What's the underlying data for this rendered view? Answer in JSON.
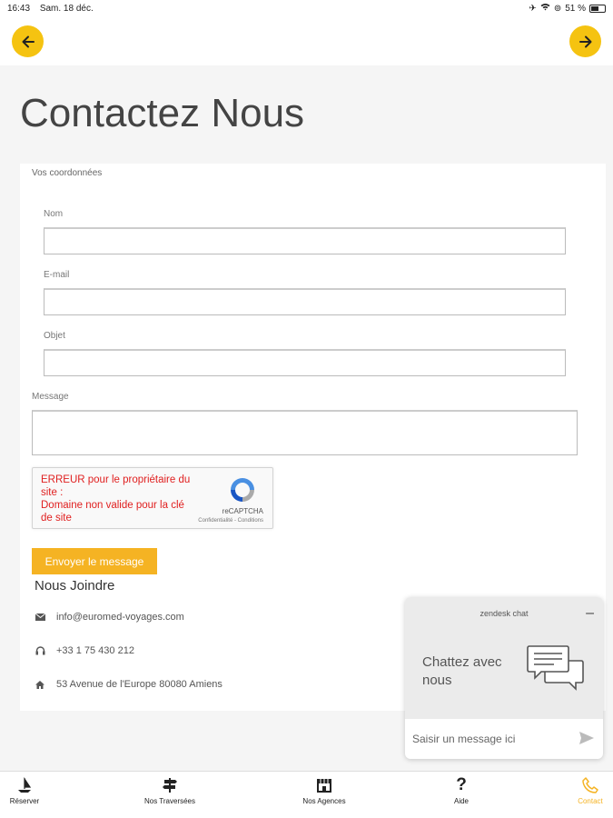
{
  "status_bar": {
    "time": "16:43",
    "date": "Sam. 18 déc.",
    "battery": "51 %",
    "icons": [
      "airplane-icon",
      "wifi-icon",
      "orientation-lock-icon",
      "battery-icon"
    ]
  },
  "nav": {
    "back_icon": "arrow-left-icon",
    "forward_icon": "arrow-right-icon",
    "accent_color": "#f5c311"
  },
  "page": {
    "title": "Contactez Nous"
  },
  "form": {
    "section_label": "Vos coordonnées",
    "name_label": "Nom",
    "email_label": "E-mail",
    "subject_label": "Objet",
    "message_label": "Message",
    "name_value": "",
    "email_value": "",
    "subject_value": "",
    "message_value": "",
    "submit_label": "Envoyer le message"
  },
  "recaptcha": {
    "error_text": "ERREUR pour le propriétaire du site :\nDomaine non valide pour la clé de site",
    "brand": "reCAPTCHA",
    "terms": "Confidentialité - Conditions"
  },
  "join": {
    "title": "Nous Joindre",
    "email": "info@euromed-voyages.com",
    "phone": "+33 1 75 430 212",
    "address": "53 Avenue de l'Europe 80080 Amiens"
  },
  "chat": {
    "brand": "zendesk chat",
    "minimize": "–",
    "cta": "Chattez avec nous",
    "placeholder": "Saisir un message ici"
  },
  "tabs": [
    {
      "label": "Réserver",
      "icon": "sailboat-icon"
    },
    {
      "label": "Nos Traversées",
      "icon": "signpost-icon"
    },
    {
      "label": "Nos Agences",
      "icon": "store-icon"
    },
    {
      "label": "Aide",
      "icon": "question-icon"
    },
    {
      "label": "Contact",
      "icon": "phone-icon",
      "active": true
    }
  ]
}
